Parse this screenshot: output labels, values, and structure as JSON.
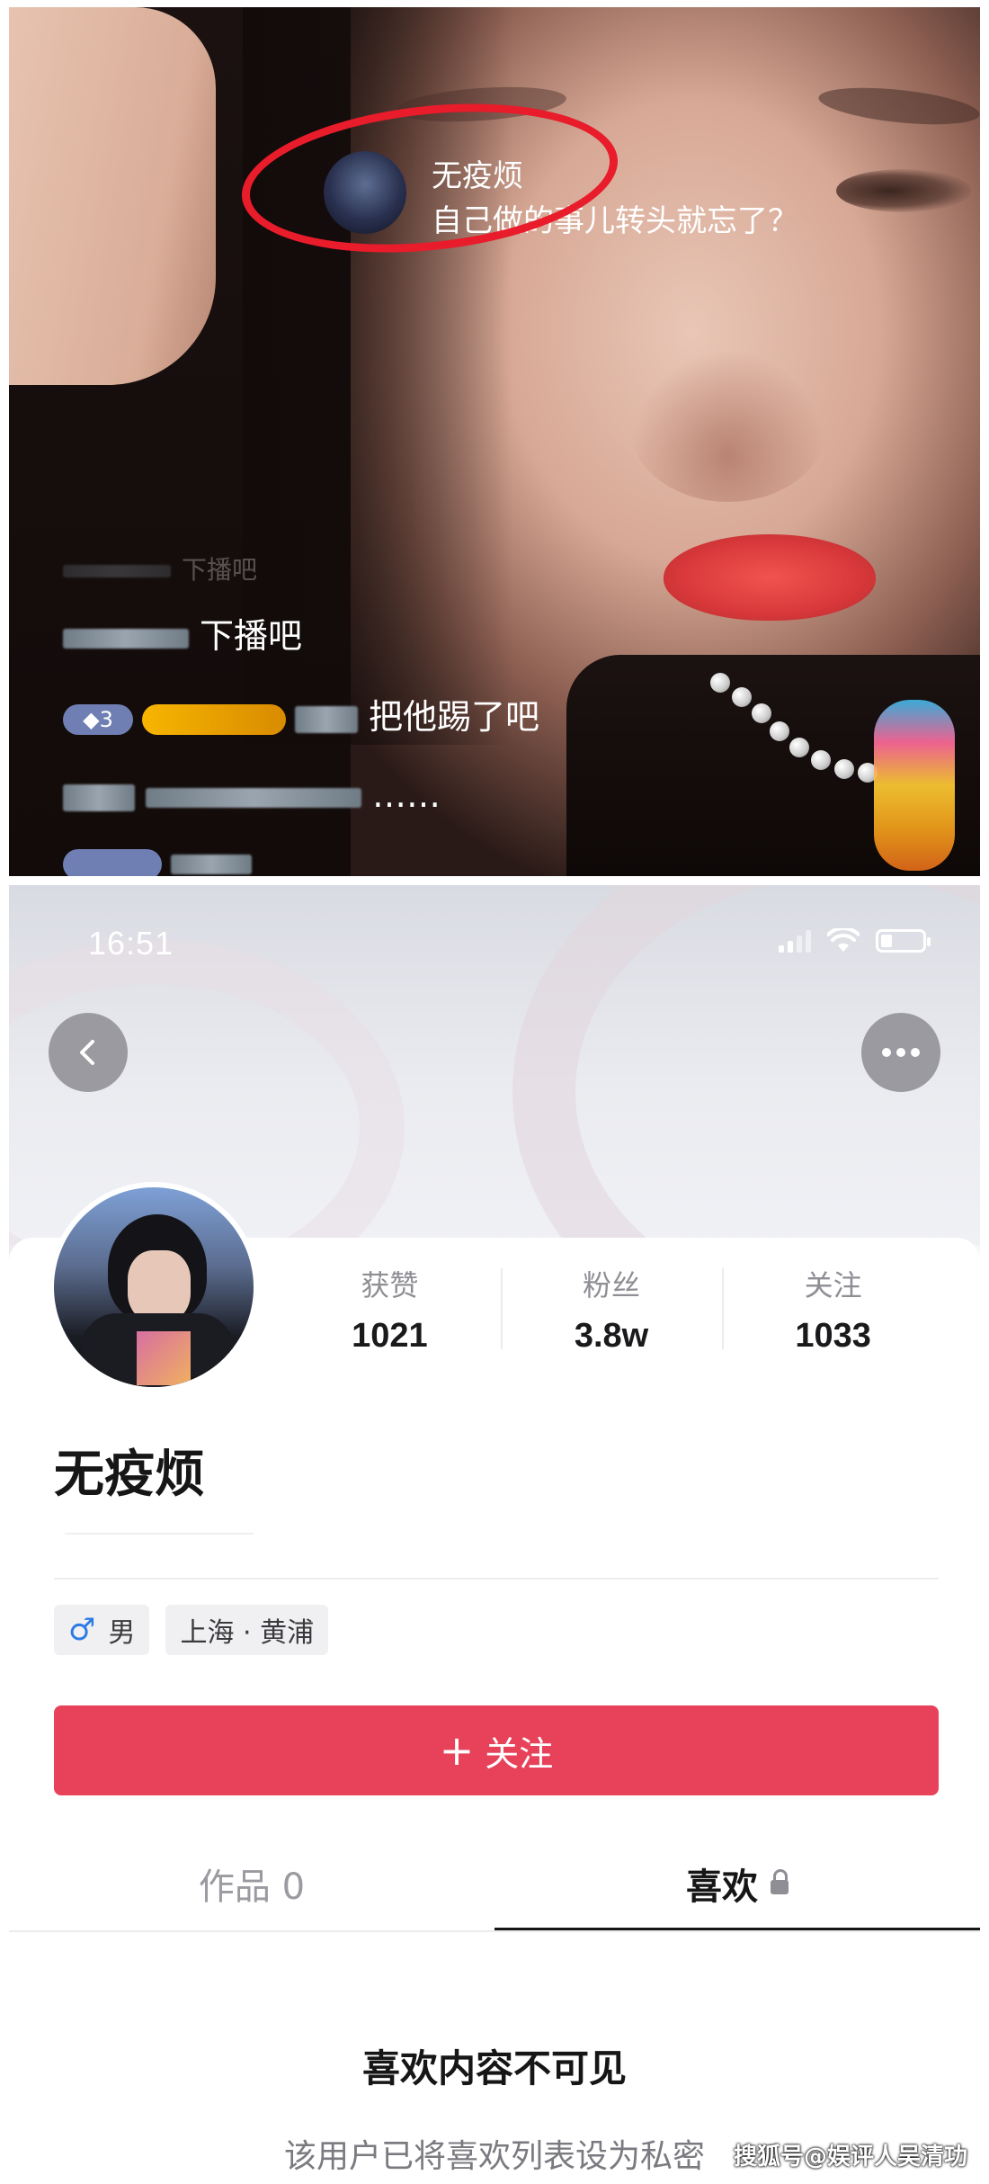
{
  "live": {
    "bubble": {
      "username": "无疫烦",
      "message": "自己做的事儿转头就忘了？"
    },
    "comments": [
      {
        "text": "下播吧"
      },
      {
        "badge_level": "3",
        "text": "把他踢了吧"
      },
      {
        "text": "……"
      }
    ],
    "faded_comment": "下播吧"
  },
  "status_bar": {
    "time": "16:51"
  },
  "profile": {
    "stats": [
      {
        "label": "获赞",
        "value": "1021"
      },
      {
        "label": "粉丝",
        "value": "3.8w"
      },
      {
        "label": "关注",
        "value": "1033"
      }
    ],
    "username": "无疫烦",
    "tags": {
      "gender_icon": "♂",
      "gender": "男",
      "location": "上海 · 黄浦"
    },
    "follow_plus": "+",
    "follow_label": "关注",
    "tabs": [
      {
        "label": "作品 0"
      },
      {
        "label": "喜欢"
      }
    ],
    "empty_title": "喜欢内容不可见",
    "empty_desc": "该用户已将喜欢列表设为私密"
  },
  "watermark": "搜狐号@娱评人吴清功",
  "colors": {
    "follow_button": "#e8425a",
    "circle_highlight": "#e81c2a",
    "male_icon": "#2c7be5"
  }
}
